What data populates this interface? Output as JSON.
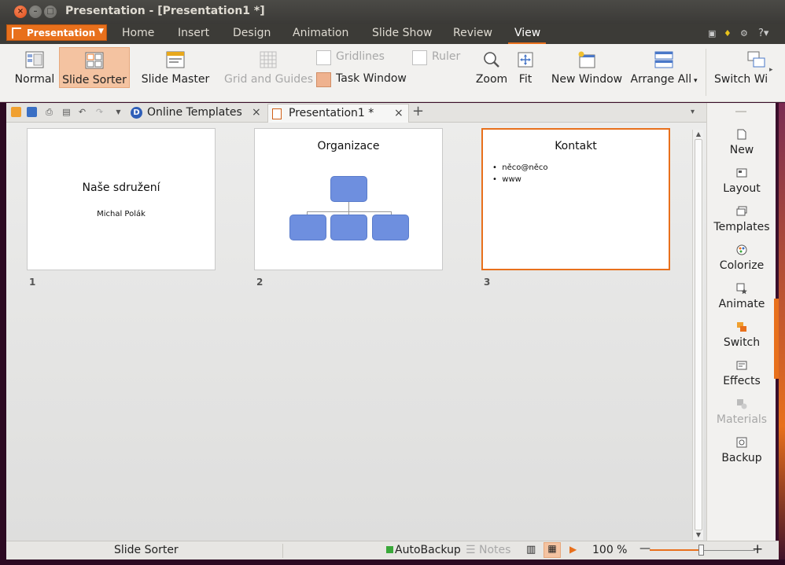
{
  "window": {
    "title": "Presentation - [Presentation1 *]"
  },
  "menu": {
    "app_button": "Presentation",
    "tabs": [
      "Home",
      "Insert",
      "Design",
      "Animation",
      "Slide Show",
      "Review",
      "View"
    ],
    "active_tab": "View",
    "help": "?"
  },
  "ribbon": {
    "normal": "Normal",
    "slide_sorter": "Slide Sorter",
    "slide_master": "Slide Master",
    "grid_and_guides": "Grid and Guides",
    "gridlines": "Gridlines",
    "ruler": "Ruler",
    "task_window": "Task Window",
    "zoom": "Zoom",
    "fit": "Fit",
    "new_window": "New Window",
    "arrange_all": "Arrange All",
    "switch_window": "Switch Wi"
  },
  "tabs": {
    "online_templates": "Online Templates",
    "presentation1": "Presentation1 *"
  },
  "slides": [
    {
      "number": "1",
      "title": "Naše sdružení",
      "subtitle": "Michal Polák"
    },
    {
      "number": "2",
      "title": "Organizace"
    },
    {
      "number": "3",
      "title": "Kontakt",
      "bullets": [
        "něco@něco",
        "www"
      ]
    }
  ],
  "taskpane": {
    "items": [
      {
        "label": "New",
        "icon": "new-slide-icon"
      },
      {
        "label": "Layout",
        "icon": "layout-icon"
      },
      {
        "label": "Templates",
        "icon": "templates-icon"
      },
      {
        "label": "Colorize",
        "icon": "colorize-icon"
      },
      {
        "label": "Animate",
        "icon": "animate-icon"
      },
      {
        "label": "Switch",
        "icon": "switch-icon"
      },
      {
        "label": "Effects",
        "icon": "effects-icon"
      },
      {
        "label": "Materials",
        "icon": "materials-icon"
      },
      {
        "label": "Backup",
        "icon": "backup-icon"
      }
    ]
  },
  "status": {
    "view_name": "Slide Sorter",
    "autobackup": "AutoBackup",
    "notes": "Notes",
    "zoom": "100 %",
    "zoom_minus": "—",
    "zoom_plus": "+",
    "zoom_level_percent": 100
  },
  "colors": {
    "accent": "#e8701c",
    "org_shape": "#6e8fdf"
  }
}
